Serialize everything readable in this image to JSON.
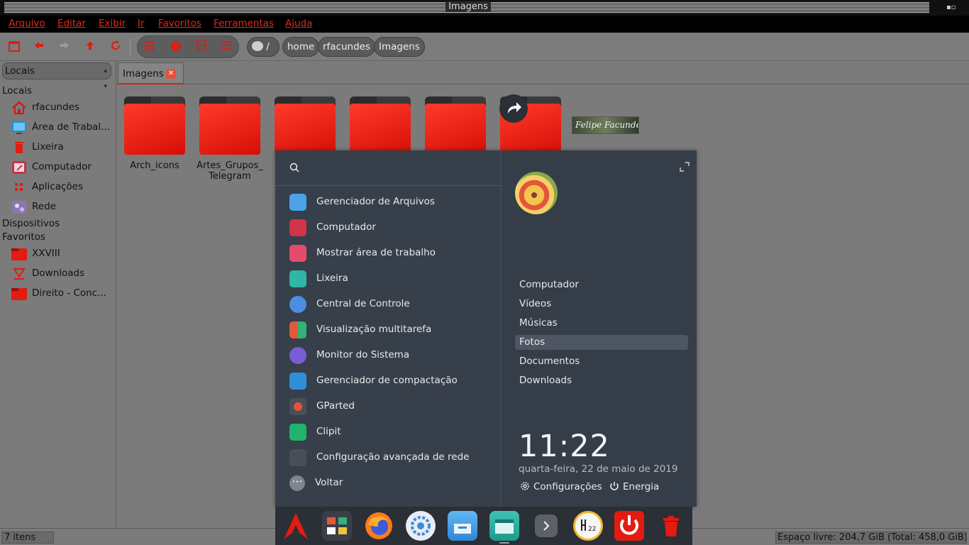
{
  "window": {
    "title": "Imagens"
  },
  "menu": [
    "Arquivo",
    "Editar",
    "Exibir",
    "Ir",
    "Favoritos",
    "Ferramentas",
    "Ajuda"
  ],
  "toolbar": {
    "nav_icons": [
      "new-tab-icon",
      "back-arrow-icon",
      "forward-arrow-icon",
      "up-arrow-icon",
      "reload-icon"
    ],
    "view_icons": [
      "icon-view-icon",
      "info-icon",
      "compact-view-icon",
      "list-view-icon"
    ],
    "path_root": "/",
    "breadcrumbs": [
      "home",
      "rfacundes",
      "Imagens"
    ]
  },
  "sidebar": {
    "selector": "Locais",
    "section_places": "Locais",
    "places": [
      {
        "label": "rfacundes",
        "icon": "home-icon"
      },
      {
        "label": "Área de Trabal...",
        "icon": "desktop-icon"
      },
      {
        "label": "Lixeira",
        "icon": "trash-icon"
      },
      {
        "label": "Computador",
        "icon": "computer-icon"
      },
      {
        "label": "Aplicações",
        "icon": "applications-icon"
      },
      {
        "label": "Rede",
        "icon": "network-icon"
      }
    ],
    "section_devices": "Dispositivos",
    "section_favorites": "Favoritos",
    "favorites": [
      {
        "label": "XXVIII",
        "icon": "folder-icon"
      },
      {
        "label": "Downloads",
        "icon": "download-icon"
      },
      {
        "label": "Direito - Conc...",
        "icon": "folder-icon"
      }
    ]
  },
  "tab": {
    "label": "Imagens"
  },
  "files": [
    {
      "name": "Arch_icons"
    },
    {
      "name": "Artes_Grupos_ Telegram"
    }
  ],
  "thumbnail_logo_text": "Felipe Facundes",
  "status": {
    "items": "7 itens",
    "free_space": "Espaço livre: 204,7 GiB (Total: 458,0 GiB)"
  },
  "launcher": {
    "apps": [
      {
        "label": "Gerenciador de Arquivos",
        "icon": "file-manager-icon",
        "color": "#4aa3e8"
      },
      {
        "label": "Computador",
        "icon": "computer-icon",
        "color": "#d2344a"
      },
      {
        "label": "Mostrar área de trabalho",
        "icon": "show-desktop-icon",
        "color": "#e54b6a"
      },
      {
        "label": "Lixeira",
        "icon": "trash-icon",
        "color": "#2fb6a4"
      },
      {
        "label": "Central de Controle",
        "icon": "control-center-icon",
        "color": "#4c8fe0"
      },
      {
        "label": "Visualização multitarefa",
        "icon": "multitask-icon",
        "color": "#3a3f47"
      },
      {
        "label": "Monitor do Sistema",
        "icon": "system-monitor-icon",
        "color": "#7a5cd6"
      },
      {
        "label": "Gerenciador de compactação",
        "icon": "archive-manager-icon",
        "color": "#2f8fd8"
      },
      {
        "label": "GParted",
        "icon": "gparted-icon",
        "color": "#4a4f57"
      },
      {
        "label": "Clipit",
        "icon": "clipit-icon",
        "color": "#21b36b"
      },
      {
        "label": "Configuração avançada de rede",
        "icon": "network-config-icon",
        "color": "#4a4f57"
      }
    ],
    "back_label": "Voltar",
    "places": [
      "Computador",
      "Vídeos",
      "Músicas",
      "Fotos",
      "Documentos",
      "Downloads"
    ],
    "selected_place": "Fotos",
    "clock": "11:22",
    "date": "quarta-feira, 22 de maio de 2019",
    "settings_label": "Configurações",
    "power_label": "Energia"
  },
  "dock": [
    "arch-logo-icon",
    "multitask-icon",
    "firefox-icon",
    "control-center-icon",
    "file-manager-icon",
    "app-store-icon",
    "show-more-icon",
    "clock-icon",
    "power-icon",
    "trash-icon"
  ],
  "colors": {
    "accent": "#e31b10",
    "launcher_bg": "#363f4a",
    "text_light": "#e8eaed"
  }
}
